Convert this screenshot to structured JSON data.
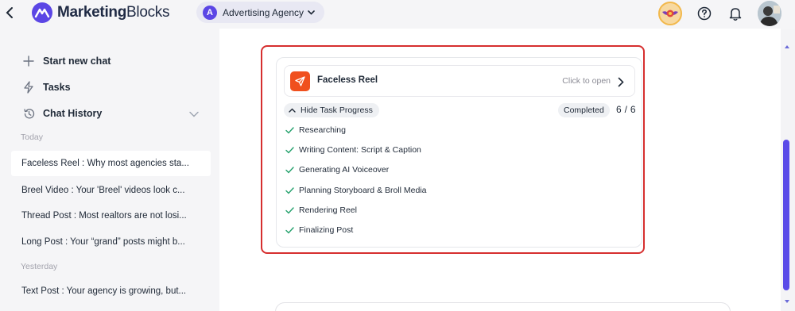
{
  "header": {
    "logo_text_bold": "Marketing",
    "logo_text_regular": "Blocks",
    "agency": {
      "initial": "A",
      "name": "Advertising Agency"
    }
  },
  "sidebar": {
    "actions": [
      {
        "label": "Start new chat",
        "icon": "plus-icon"
      },
      {
        "label": "Tasks",
        "icon": "lightning-icon"
      },
      {
        "label": "Chat History",
        "icon": "history-icon"
      }
    ],
    "sections": [
      {
        "label": "Today"
      },
      {
        "label": "Yesterday"
      }
    ],
    "items": [
      {
        "label": "Faceless Reel : Why most agencies sta...",
        "active": true
      },
      {
        "label": "Breel Video : Your 'Breel' videos look c...",
        "active": false
      },
      {
        "label": "Thread Post : Most realtors are not losi...",
        "active": false
      },
      {
        "label": "Long Post : Your “grand” posts might b...",
        "active": false
      },
      {
        "label": "Text Post : Your agency is growing, but...",
        "active": false
      }
    ]
  },
  "task": {
    "title": "Faceless Reel",
    "open_label": "Click to open",
    "hide_label": "Hide Task Progress",
    "status": "Completed",
    "progress": "6 / 6",
    "steps": [
      {
        "label": "Researching"
      },
      {
        "label": "Writing Content: Script & Caption"
      },
      {
        "label": "Generating AI Voiceover"
      },
      {
        "label": "Planning Storyboard & Broll Media"
      },
      {
        "label": "Rendering Reel"
      },
      {
        "label": "Finalizing Post"
      }
    ]
  },
  "colors": {
    "accent": "#5b46e5",
    "highlight": "#d62f2f",
    "reel_icon": "#f0501e",
    "check": "#22a06b"
  }
}
